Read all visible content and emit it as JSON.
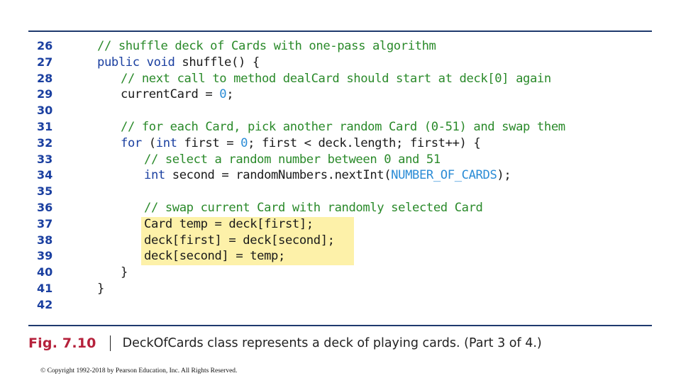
{
  "listing": {
    "lines": [
      {
        "number": "26",
        "indent": 0,
        "tokens": [
          {
            "t": "// shuffle deck of Cards with one-pass algorithm",
            "c": "comment"
          }
        ]
      },
      {
        "number": "27",
        "indent": 0,
        "tokens": [
          {
            "t": "public void ",
            "c": "keyword"
          },
          {
            "t": "shuffle() {",
            "c": "plain"
          }
        ]
      },
      {
        "number": "28",
        "indent": 1,
        "tokens": [
          {
            "t": "// next call to method dealCard should start at deck[0] again",
            "c": "comment"
          }
        ]
      },
      {
        "number": "29",
        "indent": 1,
        "tokens": [
          {
            "t": "currentCard = ",
            "c": "plain"
          },
          {
            "t": "0",
            "c": "literal"
          },
          {
            "t": ";",
            "c": "plain"
          }
        ]
      },
      {
        "number": "30",
        "indent": 0,
        "tokens": []
      },
      {
        "number": "31",
        "indent": 1,
        "tokens": [
          {
            "t": "// for each Card, pick another random Card (0-51) and swap them",
            "c": "comment"
          }
        ]
      },
      {
        "number": "32",
        "indent": 1,
        "tokens": [
          {
            "t": "for",
            "c": "keyword"
          },
          {
            "t": " (",
            "c": "plain"
          },
          {
            "t": "int",
            "c": "keyword"
          },
          {
            "t": " first = ",
            "c": "plain"
          },
          {
            "t": "0",
            "c": "literal"
          },
          {
            "t": "; first < deck.length; first++) {",
            "c": "plain"
          }
        ]
      },
      {
        "number": "33",
        "indent": 2,
        "tokens": [
          {
            "t": "// select a random number between 0 and 51",
            "c": "comment"
          }
        ]
      },
      {
        "number": "34",
        "indent": 2,
        "tokens": [
          {
            "t": "int",
            "c": "keyword"
          },
          {
            "t": " second = randomNumbers.nextInt(",
            "c": "plain"
          },
          {
            "t": "NUMBER_OF_CARDS",
            "c": "literal"
          },
          {
            "t": ");",
            "c": "plain"
          }
        ]
      },
      {
        "number": "35",
        "indent": 0,
        "tokens": []
      },
      {
        "number": "36",
        "indent": 2,
        "tokens": [
          {
            "t": "// swap current Card with randomly selected Card",
            "c": "comment"
          }
        ]
      },
      {
        "number": "37",
        "indent": 2,
        "tokens": [
          {
            "t": "Card temp = deck[first];",
            "c": "plain"
          }
        ]
      },
      {
        "number": "38",
        "indent": 2,
        "tokens": [
          {
            "t": "deck[first] = deck[second];",
            "c": "plain"
          }
        ]
      },
      {
        "number": "39",
        "indent": 2,
        "tokens": [
          {
            "t": "deck[second] = temp;",
            "c": "plain"
          }
        ]
      },
      {
        "number": "40",
        "indent": 1,
        "tokens": [
          {
            "t": "}",
            "c": "plain"
          }
        ]
      },
      {
        "number": "41",
        "indent": 0,
        "tokens": [
          {
            "t": "}",
            "c": "plain"
          }
        ]
      },
      {
        "number": "42",
        "indent": 0,
        "tokens": []
      }
    ],
    "highlighted_lines": [
      "37",
      "38",
      "39"
    ],
    "colors": {
      "line_number": "#1a3fa0",
      "comment": "#2a8a2a",
      "keyword": "#1a3fa0",
      "literal": "#2b8cd6",
      "highlight": "#fdf1a9",
      "rule": "#1f3a6e"
    }
  },
  "caption": {
    "label": "Fig. 7.10",
    "class_name": "DeckOfCards",
    "text": " class represents a deck of playing cards. (Part 3 of 4.)",
    "label_color": "#b5213b"
  },
  "footer": {
    "copyright": "© Copyright 1992-2018 by Pearson Education, Inc. All Rights Reserved."
  }
}
